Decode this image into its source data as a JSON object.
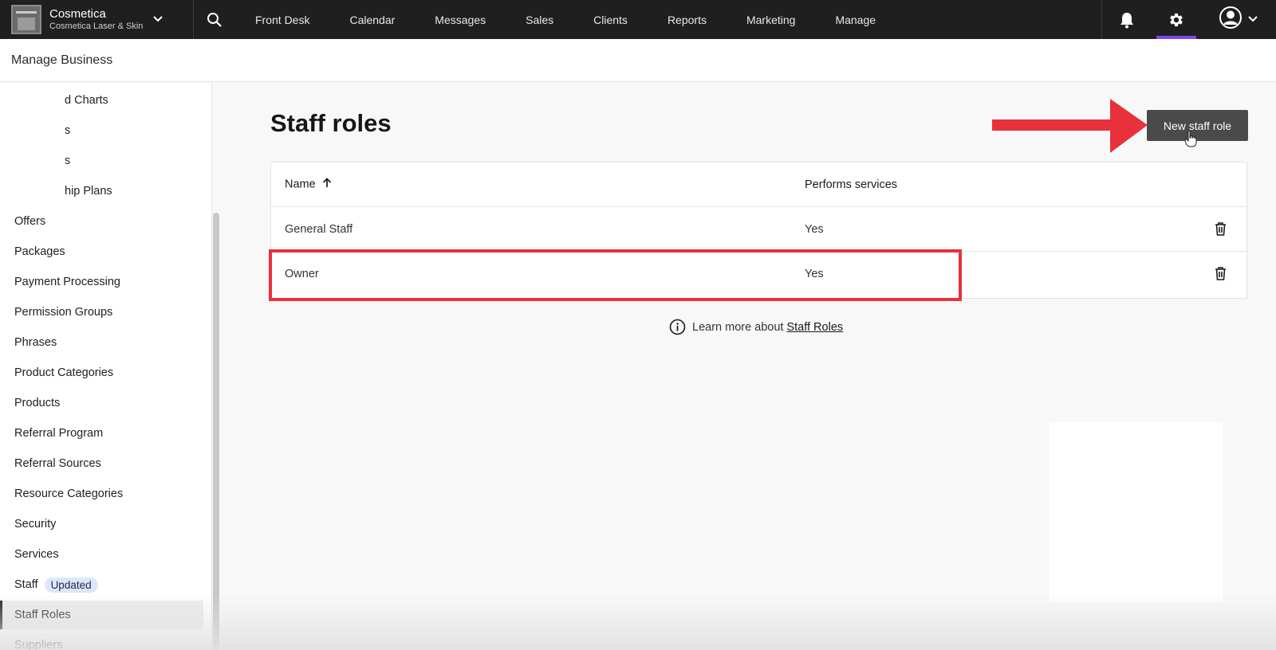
{
  "topnav": {
    "business_name": "Cosmetica",
    "business_location": "Cosmetica Laser & Skin",
    "items": [
      "Front Desk",
      "Calendar",
      "Messages",
      "Sales",
      "Clients",
      "Reports",
      "Marketing",
      "Manage"
    ],
    "active_icon": "gear-icon",
    "accent_color": "#7b46f0"
  },
  "header": {
    "title": "Manage Business"
  },
  "sidebar": {
    "items": [
      {
        "label": "d Charts"
      },
      {
        "label": "s"
      },
      {
        "label": "s"
      },
      {
        "label": "hip Plans"
      },
      {
        "label": "Offers"
      },
      {
        "label": "Packages"
      },
      {
        "label": "Payment Processing"
      },
      {
        "label": "Permission Groups"
      },
      {
        "label": "Phrases"
      },
      {
        "label": "Product Categories"
      },
      {
        "label": "Products"
      },
      {
        "label": "Referral Program"
      },
      {
        "label": "Referral Sources"
      },
      {
        "label": "Resource Categories"
      },
      {
        "label": "Security"
      },
      {
        "label": "Services"
      },
      {
        "label": "Staff",
        "badge": "Updated"
      },
      {
        "label": "Staff Roles",
        "active": true
      },
      {
        "label": "Suppliers"
      }
    ]
  },
  "main": {
    "title": "Staff roles",
    "new_button_label": "New staff role",
    "table": {
      "columns": [
        "Name",
        "Performs services"
      ],
      "sort_column": "Name",
      "sort_direction": "ascending",
      "rows": [
        {
          "name": "General Staff",
          "performs_services": "Yes"
        },
        {
          "name": "Owner",
          "performs_services": "Yes"
        }
      ]
    },
    "learn_more_text": "Learn more about",
    "learn_more_link": "Staff Roles"
  },
  "annotation_color": "#e8313b"
}
